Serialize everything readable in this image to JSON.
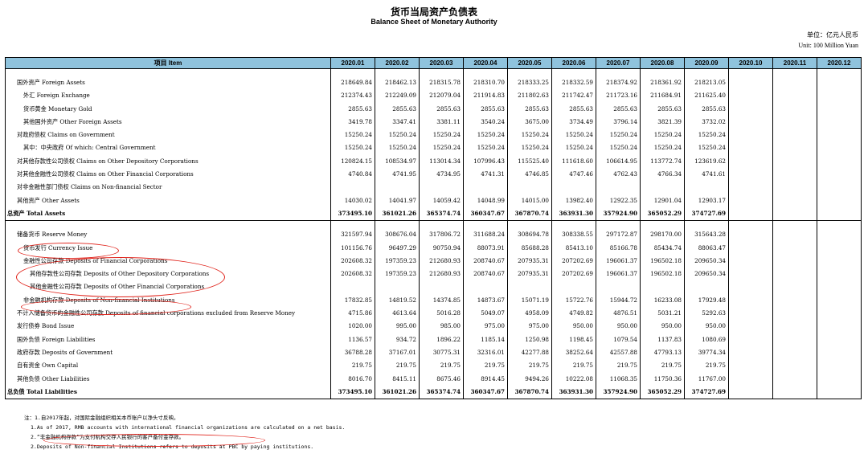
{
  "header": {
    "title_cn": "货币当局资产负债表",
    "title_en": "Balance Sheet of Monetary Authority",
    "unit_cn": "单位：亿元人民币",
    "unit_en": "Unit: 100 Million Yuan"
  },
  "table": {
    "item_header": "项目 Item",
    "months": [
      "2020.01",
      "2020.02",
      "2020.03",
      "2020.04",
      "2020.05",
      "2020.06",
      "2020.07",
      "2020.08",
      "2020.09",
      "2020.10",
      "2020.11",
      "2020.12"
    ],
    "rows": [
      {
        "label": "国外资产  Foreign Assets",
        "values": [
          "218649.84",
          "218462.13",
          "218315.78",
          "218310.70",
          "218333.25",
          "218332.59",
          "218374.92",
          "218361.92",
          "218213.05"
        ]
      },
      {
        "label": "外汇  Foreign Exchange",
        "values": [
          "212374.43",
          "212249.09",
          "212079.04",
          "211914.83",
          "211802.63",
          "211742.47",
          "211723.16",
          "211684.91",
          "211625.40"
        ]
      },
      {
        "label": "货币黄金  Monetary Gold",
        "values": [
          "2855.63",
          "2855.63",
          "2855.63",
          "2855.63",
          "2855.63",
          "2855.63",
          "2855.63",
          "2855.63",
          "2855.63"
        ]
      },
      {
        "label": "其他国外资产  Other Foreign Assets",
        "values": [
          "3419.78",
          "3347.41",
          "3381.11",
          "3540.24",
          "3675.00",
          "3734.49",
          "3796.14",
          "3821.39",
          "3732.02"
        ]
      },
      {
        "label": "对政府债权  Claims on Government",
        "values": [
          "15250.24",
          "15250.24",
          "15250.24",
          "15250.24",
          "15250.24",
          "15250.24",
          "15250.24",
          "15250.24",
          "15250.24"
        ]
      },
      {
        "label": "其中：中央政府  Of which: Central Government",
        "values": [
          "15250.24",
          "15250.24",
          "15250.24",
          "15250.24",
          "15250.24",
          "15250.24",
          "15250.24",
          "15250.24",
          "15250.24"
        ]
      },
      {
        "label": "对其他存款性公司债权  Claims on Other Depository Corporations",
        "values": [
          "120824.15",
          "108534.97",
          "113014.34",
          "107996.43",
          "115525.40",
          "111618.60",
          "106614.95",
          "113772.74",
          "123619.62"
        ]
      },
      {
        "label": "对其他金融性公司债权  Claims on Other Financial Corporations",
        "values": [
          "4740.84",
          "4741.95",
          "4734.95",
          "4741.31",
          "4746.85",
          "4747.46",
          "4762.43",
          "4766.34",
          "4741.61"
        ]
      },
      {
        "label": "对非金融性部门债权  Claims on Non-financial Sector",
        "values": [
          "",
          "",
          "",
          "",
          "",
          "",
          "",
          "",
          ""
        ]
      },
      {
        "label": "其他资产  Other Assets",
        "values": [
          "14030.02",
          "14041.97",
          "14059.42",
          "14048.99",
          "14015.00",
          "13982.40",
          "12922.35",
          "12901.04",
          "12903.17"
        ]
      },
      {
        "label": "总资产  Total Assets",
        "values": [
          "373495.10",
          "361021.26",
          "365374.74",
          "360347.67",
          "367870.74",
          "363931.30",
          "357924.90",
          "365052.29",
          "374727.69"
        ]
      },
      {
        "label": "储备货币  Reserve Money",
        "values": [
          "321597.94",
          "308676.04",
          "317806.72",
          "311688.24",
          "308694.78",
          "308338.55",
          "297172.87",
          "298170.00",
          "315643.28"
        ]
      },
      {
        "label": "货币发行  Currency Issue",
        "values": [
          "101156.76",
          "96497.29",
          "90750.94",
          "88073.91",
          "85688.28",
          "85413.10",
          "85166.78",
          "85434.74",
          "88063.47"
        ]
      },
      {
        "label": "金融性公司存款  Deposits of Financial Corporations",
        "values": [
          "202608.32",
          "197359.23",
          "212680.93",
          "208740.67",
          "207935.31",
          "207202.69",
          "196061.37",
          "196502.18",
          "209650.34"
        ]
      },
      {
        "label": "其他存款性公司存款  Deposits of Other Depository Corporations",
        "values": [
          "202608.32",
          "197359.23",
          "212680.93",
          "208740.67",
          "207935.31",
          "207202.69",
          "196061.37",
          "196502.18",
          "209650.34"
        ]
      },
      {
        "label": "其他金融性公司存款  Deposits of Other Financial Corporations",
        "values": [
          "",
          "",
          "",
          "",
          "",
          "",
          "",
          "",
          ""
        ]
      },
      {
        "label": "非金融机构存款  Deposits of Non-financial Institutions",
        "values": [
          "17832.85",
          "14819.52",
          "14374.85",
          "14873.67",
          "15071.19",
          "15722.76",
          "15944.72",
          "16233.08",
          "17929.48"
        ]
      },
      {
        "label": "不计入储备货币的金融性公司存款  Deposits of financial corporations excluded from Reserve Money",
        "values": [
          "4715.86",
          "4613.64",
          "5016.28",
          "5049.07",
          "4958.09",
          "4749.82",
          "4876.51",
          "5031.21",
          "5292.63"
        ]
      },
      {
        "label": "发行债券  Bond Issue",
        "values": [
          "1020.00",
          "995.00",
          "985.00",
          "975.00",
          "975.00",
          "950.00",
          "950.00",
          "950.00",
          "950.00"
        ]
      },
      {
        "label": "国外负债  Foreign Liabilities",
        "values": [
          "1136.57",
          "934.72",
          "1896.22",
          "1185.14",
          "1250.98",
          "1198.45",
          "1079.54",
          "1137.83",
          "1080.69"
        ]
      },
      {
        "label": "政府存款  Deposits of Government",
        "values": [
          "36788.28",
          "37167.01",
          "30775.31",
          "32316.01",
          "42277.88",
          "38252.64",
          "42557.88",
          "47793.13",
          "39774.34"
        ]
      },
      {
        "label": "自有资金  Own Capital",
        "values": [
          "219.75",
          "219.75",
          "219.75",
          "219.75",
          "219.75",
          "219.75",
          "219.75",
          "219.75",
          "219.75"
        ]
      },
      {
        "label": "其他负债  Other Liabilities",
        "values": [
          "8016.70",
          "8415.11",
          "8675.46",
          "8914.45",
          "9494.26",
          "10222.08",
          "11068.35",
          "11750.36",
          "11767.00"
        ]
      },
      {
        "label": "总负债  Total Liabilities",
        "values": [
          "373495.10",
          "361021.26",
          "365374.74",
          "360347.67",
          "367870.74",
          "363931.30",
          "357924.90",
          "365052.29",
          "374727.69"
        ]
      }
    ]
  },
  "notes": {
    "n1": "注：1.自2017年起，对国际金融组织相关本币账户以净头寸反映。",
    "n2": "1.As of 2017, RMB accounts with international financial organizations are calculated on a net basis.",
    "n3": "2.“非金融机构存款”为支付机构交存人民银行的客户备付金存款。",
    "n4": "2.Deposits of Non-financial Institutions refers to deposits at PBC by paying institutions."
  },
  "colors": {
    "header_bg": "#8fc3dd",
    "annotation": "#e0231b"
  }
}
